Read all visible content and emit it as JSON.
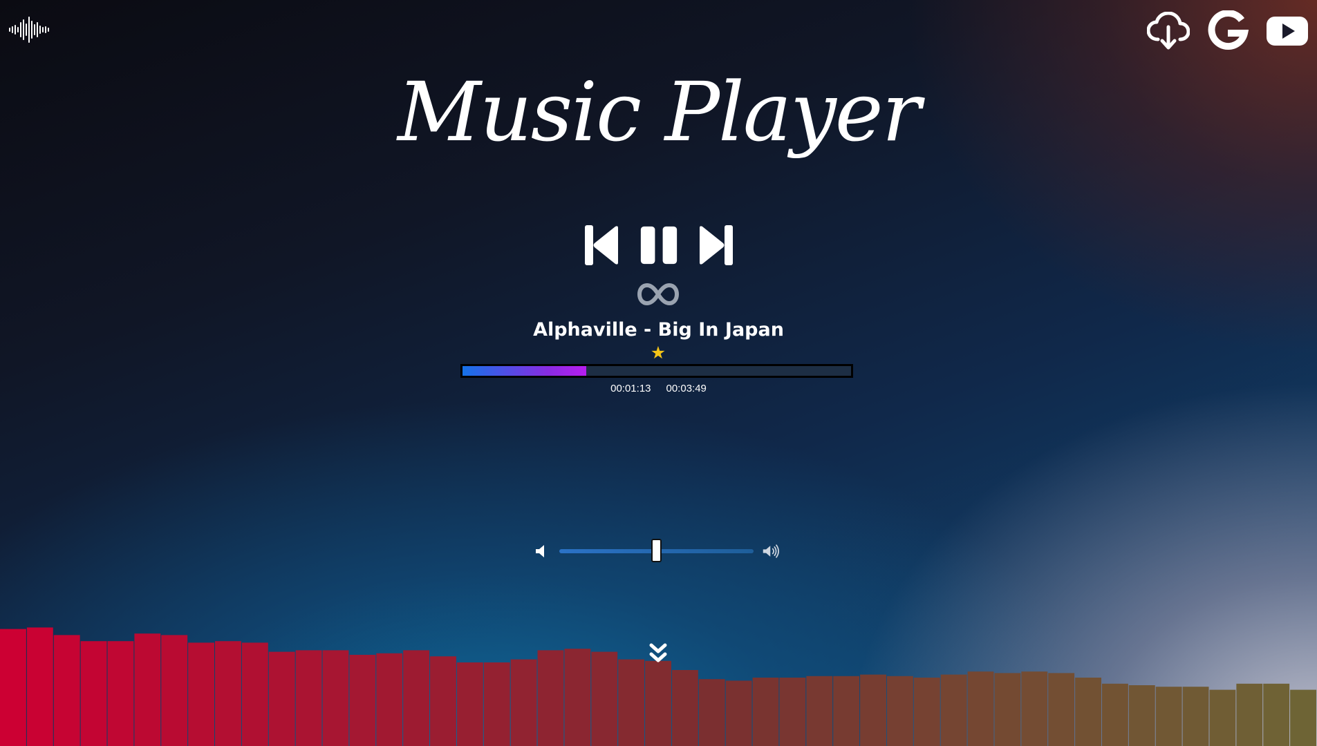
{
  "app": {
    "title": "Music Player"
  },
  "header": {
    "logo_icon": "soundwave-icon",
    "links": [
      {
        "name": "download-cloud-icon",
        "label": "Download"
      },
      {
        "name": "google-icon",
        "label": "Google"
      },
      {
        "name": "youtube-icon",
        "label": "YouTube"
      }
    ]
  },
  "controls": {
    "prev_icon": "skip-previous-icon",
    "pause_icon": "pause-icon",
    "next_icon": "skip-next-icon",
    "loop_icon": "infinity-icon"
  },
  "track": {
    "title": "Alphaville - Big In Japan",
    "favorite": "★",
    "elapsed": "00:01:13",
    "duration": "00:03:49",
    "progress_fraction": 0.319
  },
  "volume": {
    "level_fraction": 0.5,
    "mute_icon": "volume-low-icon",
    "max_icon": "volume-high-icon"
  },
  "visualizer": {
    "levels": [
      0.77,
      0.78,
      0.73,
      0.69,
      0.69,
      0.74,
      0.73,
      0.68,
      0.69,
      0.68,
      0.62,
      0.63,
      0.63,
      0.6,
      0.61,
      0.63,
      0.59,
      0.55,
      0.55,
      0.57,
      0.63,
      0.64,
      0.62,
      0.57,
      0.56,
      0.5,
      0.44,
      0.43,
      0.45,
      0.45,
      0.46,
      0.46,
      0.47,
      0.46,
      0.45,
      0.47,
      0.49,
      0.48,
      0.49,
      0.48,
      0.45,
      0.41,
      0.4,
      0.39,
      0.39,
      0.37,
      0.41,
      0.41,
      0.37
    ],
    "color_start": "#cc0033",
    "color_mid": "#7a3030",
    "color_end": "#6e6435"
  },
  "scroll_icon": "double-chevron-down-icon",
  "colors": {
    "accent_start": "#1572e8",
    "accent_end": "#b61ef0",
    "star": "#f5c518"
  }
}
